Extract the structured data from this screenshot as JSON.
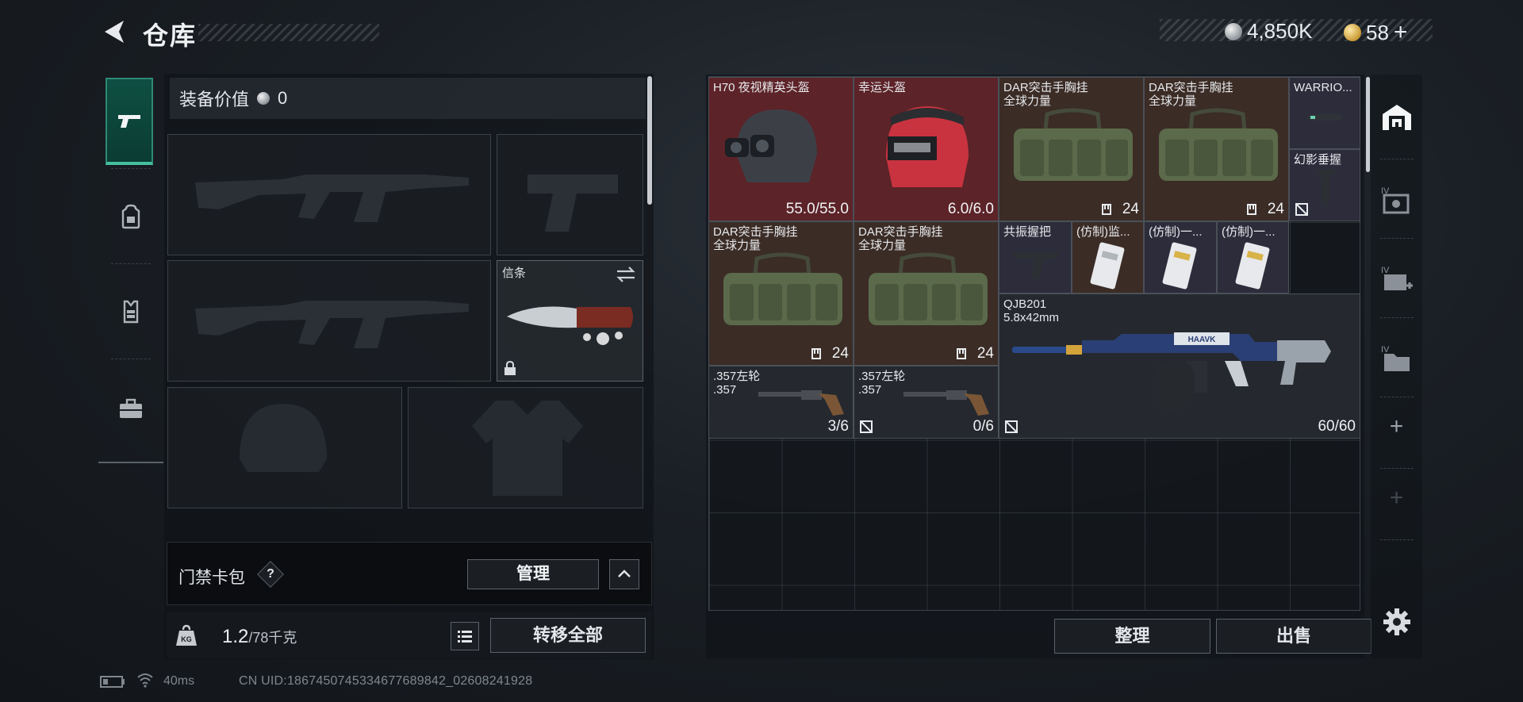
{
  "header": {
    "title": "仓库",
    "currencies": [
      {
        "name": "silver-coin",
        "value": "4,850K"
      },
      {
        "name": "gold-coin",
        "value": "58"
      }
    ],
    "add_symbol": "+"
  },
  "left_nav": {
    "items": [
      {
        "icon": "pistol-icon",
        "active": true
      },
      {
        "icon": "backpack-icon",
        "active": false
      },
      {
        "icon": "chest-rig-icon",
        "active": false
      },
      {
        "icon": "briefcase-icon",
        "active": false
      }
    ]
  },
  "loadout": {
    "equip_value_label": "装备价值",
    "equip_value": "0",
    "slots": [
      {
        "id": "primary-weapon-1",
        "icon": "assault-rifle-icon"
      },
      {
        "id": "sidearm",
        "icon": "pistol-icon"
      },
      {
        "id": "primary-weapon-2",
        "icon": "assault-rifle-icon"
      },
      {
        "id": "melee",
        "icon": "knife-icon",
        "label": "信条",
        "locked": true
      },
      {
        "id": "helmet",
        "icon": "helmet-icon"
      },
      {
        "id": "body-armor",
        "icon": "body-armor-icon"
      }
    ],
    "keycard": {
      "label": "门禁卡包",
      "help": "?",
      "manage_label": "管理"
    },
    "weight": {
      "current": "1.2",
      "max": "/78千克"
    },
    "transfer_all_label": "转移全部"
  },
  "inventory": {
    "items": [
      {
        "name": "H70 夜视精英头盔",
        "count": "55.0/55.0",
        "rarity": "red",
        "icon": "nvg-helmet-icon"
      },
      {
        "name": "幸运头盔",
        "count": "6.0/6.0",
        "rarity": "red",
        "icon": "red-helmet-icon"
      },
      {
        "name": "DAR突击手胸挂\n全球力量",
        "count": "24",
        "rarity": "brown",
        "icon": "chest-rig-icon"
      },
      {
        "name": "DAR突击手胸挂\n全球力量",
        "count": "24",
        "rarity": "brown",
        "icon": "chest-rig-icon"
      },
      {
        "name": "WARRIO...",
        "count": "",
        "rarity": "purple",
        "icon": "suppressor-icon"
      },
      {
        "name": "幻影垂握",
        "count": "",
        "rarity": "purple",
        "icon": "vertical-grip-icon"
      },
      {
        "name": "DAR突击手胸挂\n全球力量",
        "count": "24",
        "rarity": "brown",
        "icon": "chest-rig-icon"
      },
      {
        "name": "DAR突击手胸挂\n全球力量",
        "count": "24",
        "rarity": "brown",
        "icon": "chest-rig-icon"
      },
      {
        "name": "共振握把",
        "count": "",
        "rarity": "purple",
        "icon": "grip-icon"
      },
      {
        "name": "(仿制)监...",
        "count": "",
        "rarity": "brown",
        "icon": "access-card-icon"
      },
      {
        "name": "(仿制)一...",
        "count": "",
        "rarity": "purple",
        "icon": "access-card-icon"
      },
      {
        "name": "(仿制)一...",
        "count": "",
        "rarity": "purple",
        "icon": "access-card-icon"
      },
      {
        "name": "QJB201\n5.8x42mm",
        "count": "60/60",
        "rarity": "gray",
        "icon": "machine-gun-icon",
        "decal": "HAAVK"
      },
      {
        "name": ".357左轮\n.357",
        "count": "3/6",
        "rarity": "gray",
        "icon": "revolver-icon"
      },
      {
        "name": ".357左轮\n.357",
        "count": "0/6",
        "rarity": "gray",
        "icon": "revolver-icon"
      }
    ],
    "sort_label": "整理",
    "sell_label": "出售"
  },
  "right_column": {
    "tabs": [
      {
        "icon": "warehouse-icon",
        "active": true
      },
      {
        "icon": "storage-crate-icon",
        "tier": "IV"
      },
      {
        "icon": "storage-add-icon",
        "tier": "IV"
      },
      {
        "icon": "storage-folder-icon",
        "tier": "IV"
      }
    ],
    "plus_symbol": "+"
  },
  "footer": {
    "ping": "40ms",
    "uid": "CN UID:1867450745334677689842_02608241928"
  },
  "colors": {
    "rarity_red": "#5c2328",
    "rarity_brown": "#3b2c26",
    "rarity_purple": "#2c2c3b",
    "accent_green": "#44c09c"
  }
}
